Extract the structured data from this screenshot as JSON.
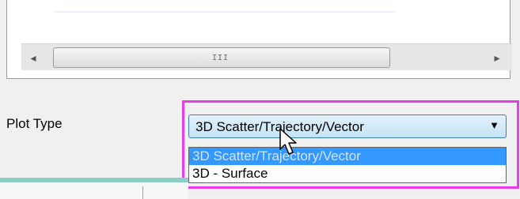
{
  "scrollbar": {
    "left_arrow": "◂",
    "right_arrow": "▸",
    "grip": "III"
  },
  "plot_type": {
    "label": "Plot Type",
    "selected": "3D Scatter/Trajectory/Vector",
    "dropdown_arrow": "▼",
    "options": [
      "3D Scatter/Trajectory/Vector",
      "3D - Surface"
    ]
  },
  "colors": {
    "highlight_border": "#e83de6",
    "selected_option_bg": "#3399ff",
    "combo_border": "#3c7fb1",
    "teal_bar": "#8dcfc7"
  }
}
